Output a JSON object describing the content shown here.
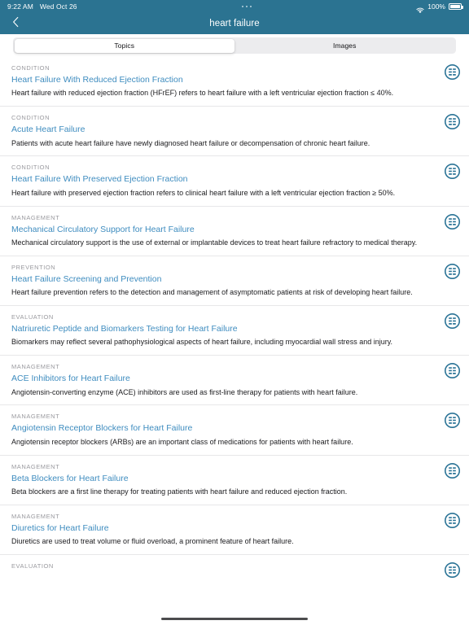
{
  "status_bar": {
    "time": "9:22 AM",
    "date": "Wed Oct 26",
    "battery_percent": "100%",
    "wifi_icon": "wifi-icon",
    "battery_icon": "battery-icon",
    "multitask_indicator": "multitasking-dots-icon"
  },
  "nav": {
    "back_icon": "chevron-left-icon",
    "title": "heart failure"
  },
  "segmented_control": {
    "selected": "Topics",
    "tabs": [
      {
        "label": "Topics",
        "active": true
      },
      {
        "label": "Images",
        "active": false
      }
    ]
  },
  "colors": {
    "header_teal": "#2b7391",
    "link_blue": "#3e8cbf",
    "icon_teal": "#2a7396",
    "category_gray": "#9a9a9f",
    "divider": "#e7e7e9",
    "segment_track": "#ececee"
  },
  "list": {
    "row_icon_name": "list-outline-icon",
    "rows": [
      {
        "category": "CONDITION",
        "title": "Heart Failure With Reduced Ejection Fraction",
        "description": "Heart failure with reduced ejection fraction (HFrEF) refers to heart failure with a left ventricular ejection fraction ≤ 40%."
      },
      {
        "category": "CONDITION",
        "title": "Acute Heart Failure",
        "description": "Patients with acute heart failure have newly diagnosed heart failure or decompensation of chronic heart failure."
      },
      {
        "category": "CONDITION",
        "title": "Heart Failure With Preserved Ejection Fraction",
        "description": "Heart failure with preserved ejection fraction refers to clinical heart failure with a left ventricular ejection fraction ≥ 50%."
      },
      {
        "category": "MANAGEMENT",
        "title": "Mechanical Circulatory Support for Heart Failure",
        "description": "Mechanical circulatory support is the use of external or implantable devices to treat heart failure refractory to medical therapy."
      },
      {
        "category": "PREVENTION",
        "title": "Heart Failure Screening and Prevention",
        "description": "Heart failure prevention refers to the detection and management of asymptomatic patients at risk of developing heart failure."
      },
      {
        "category": "EVALUATION",
        "title": "Natriuretic Peptide and Biomarkers Testing for Heart Failure",
        "description": "Biomarkers may reflect several pathophysiological aspects of heart failure, including myocardial wall stress and injury."
      },
      {
        "category": "MANAGEMENT",
        "title": "ACE Inhibitors for Heart Failure",
        "description": "Angiotensin-converting enzyme (ACE) inhibitors are used as first-line therapy for patients with heart failure."
      },
      {
        "category": "MANAGEMENT",
        "title": "Angiotensin Receptor Blockers for Heart Failure",
        "description": "Angiotensin receptor blockers (ARBs) are an important class of medications for patients with heart failure."
      },
      {
        "category": "MANAGEMENT",
        "title": "Beta Blockers for Heart Failure",
        "description": "Beta blockers are a first line therapy for treating patients with heart failure and reduced ejection fraction."
      },
      {
        "category": "MANAGEMENT",
        "title": "Diuretics for Heart Failure",
        "description": "Diuretics are used to treat volume or fluid overload, a prominent feature of heart failure."
      },
      {
        "category": "EVALUATION",
        "title": "",
        "description": ""
      }
    ]
  },
  "home_indicator": "home-indicator-bar"
}
